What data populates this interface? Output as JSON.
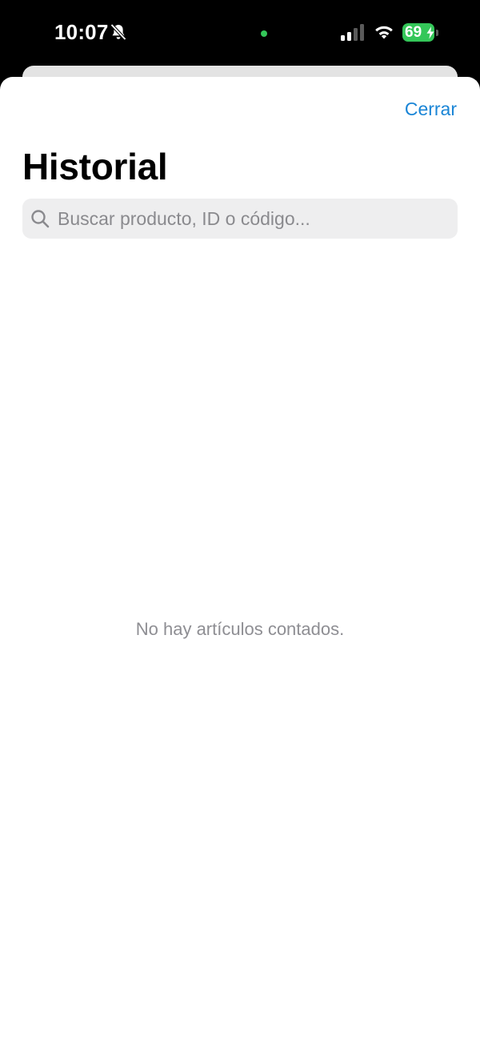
{
  "status_bar": {
    "time": "10:07",
    "bell_icon": "bell-slash-icon",
    "camera_indicator_color": "#34c759",
    "signal_icon": "cellular-signal-icon",
    "wifi_icon": "wifi-icon",
    "battery_level": "69",
    "battery_color": "#34c759",
    "charging_icon": "bolt-icon"
  },
  "sheet": {
    "close_label": "Cerrar",
    "title": "Historial",
    "search": {
      "icon": "search-icon",
      "placeholder": "Buscar producto, ID o código...",
      "value": ""
    },
    "empty_message": "No hay artículos contados."
  },
  "colors": {
    "accent": "#1a85d6",
    "background": "#ffffff",
    "search_field_bg": "#eeeeef",
    "muted_text": "#8e8e93"
  }
}
